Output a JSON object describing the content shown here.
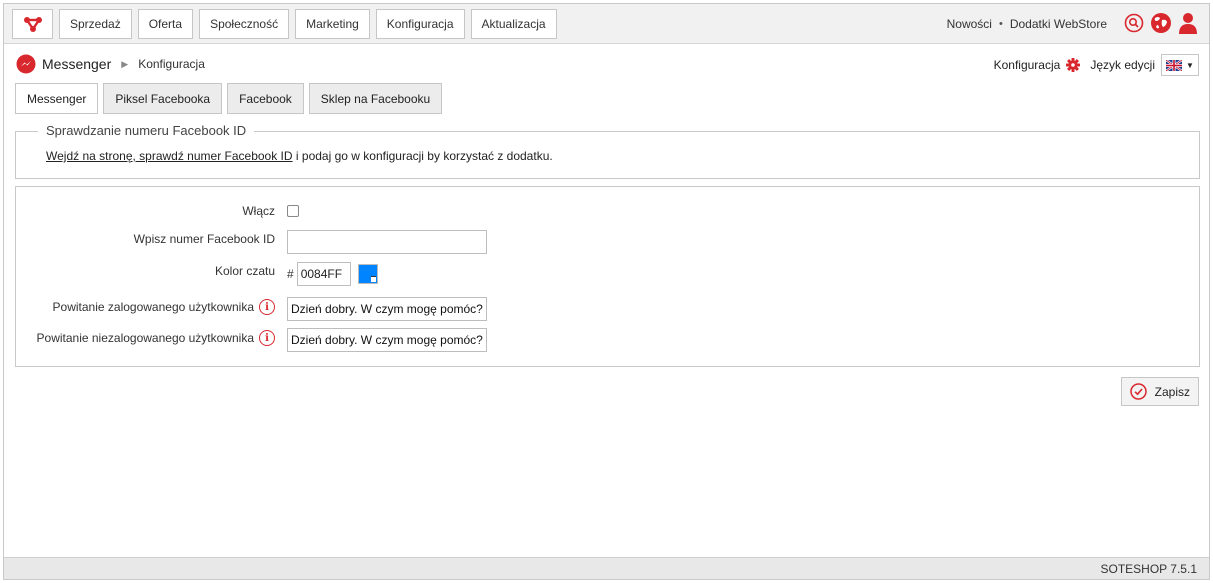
{
  "topbar": {
    "nav": [
      "Sprzedaż",
      "Oferta",
      "Społeczność",
      "Marketing",
      "Konfiguracja",
      "Aktualizacja"
    ],
    "links": [
      "Nowości",
      "Dodatki WebStore"
    ],
    "separator": "•",
    "icons": [
      "search-icon",
      "globe-icon",
      "user-icon"
    ],
    "accent": "#d9272e"
  },
  "breadcrumb": {
    "app": "Messenger",
    "section": "Konfiguracja"
  },
  "tools": {
    "config_label": "Konfiguracja",
    "language_label": "Język edycji",
    "language_flag": "uk-flag-icon"
  },
  "tabs": [
    "Messenger",
    "Piksel Facebooka",
    "Facebook",
    "Sklep na Facebooku"
  ],
  "active_tab": "Messenger",
  "facebook_id_box": {
    "legend": "Sprawdzanie numeru Facebook ID",
    "link_text": "Wejdź na stronę, sprawdź numer Facebook ID",
    "rest_text": " i podaj go w konfiguracji by korzystać z dodatku."
  },
  "form": {
    "enable_label": "Włącz",
    "enable_checked": false,
    "facebook_id_label": "Wpisz numer Facebook ID",
    "facebook_id_value": "",
    "color_label": "Kolor czatu",
    "color_hash": "#",
    "color_value": "0084FF",
    "color_swatch": "#0084FF",
    "greeting_logged_label": "Powitanie zalogowanego użytkownika",
    "greeting_logged_value": "Dzień dobry. W czym mogę pomóc?",
    "greeting_guest_label": "Powitanie niezalogowanego użytkownika",
    "greeting_guest_value": "Dzień dobry. W czym mogę pomóc?"
  },
  "save_label": "Zapisz",
  "footer": "SOTESHOP 7.5.1"
}
